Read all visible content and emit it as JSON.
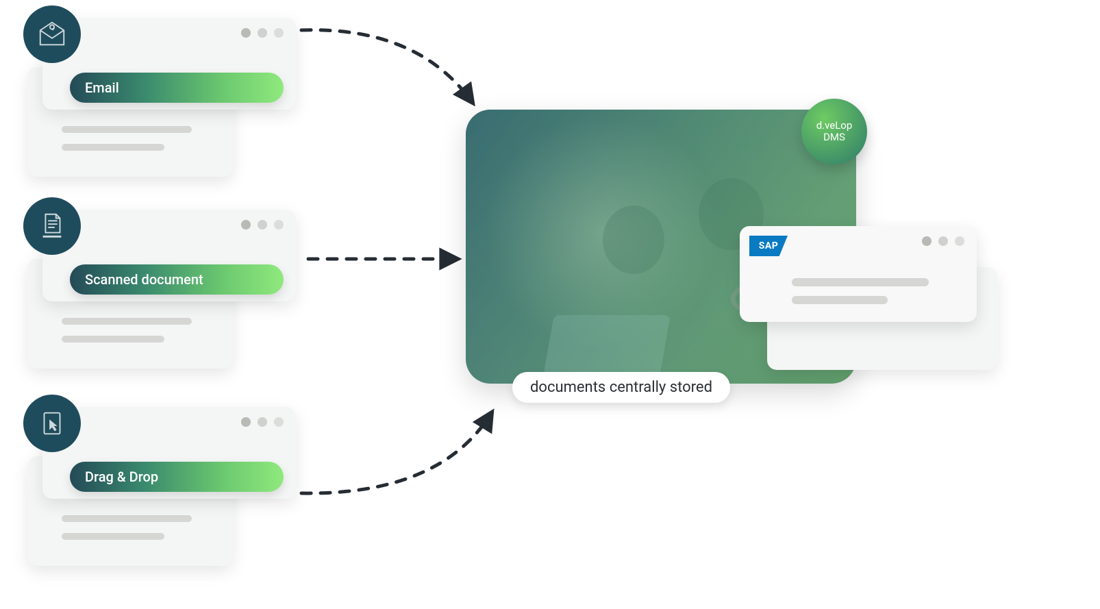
{
  "sources": [
    {
      "id": "email",
      "label": "Email",
      "icon": "email-icon"
    },
    {
      "id": "scan",
      "label": "Scanned document",
      "icon": "scan-icon"
    },
    {
      "id": "drag",
      "label": "Drag & Drop",
      "icon": "cursor-icon"
    }
  ],
  "destination": {
    "badge_line1": "d.veLop",
    "badge_line2": "DMS",
    "integration_logo": "SAP",
    "caption": "documents centrally stored"
  },
  "colors": {
    "icon_circle": "#1f4c5c",
    "pill_gradient_start": "#244a57",
    "pill_gradient_end": "#8fe97d",
    "arrow": "#252c34"
  }
}
